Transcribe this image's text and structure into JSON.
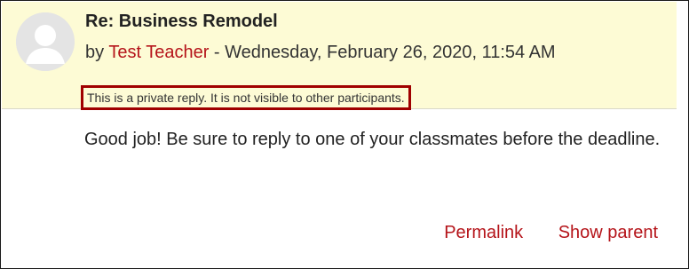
{
  "post": {
    "title": "Re: Business Remodel",
    "by_prefix": "by ",
    "author": "Test Teacher",
    "date_sep": " - ",
    "date": "Wednesday, February 26, 2020, 11:54 AM",
    "private_note": "This is a private reply. It is not visible to other participants.",
    "message": "Good job! Be sure to reply to one of your classmates before the deadline."
  },
  "commands": {
    "permalink": "Permalink",
    "show_parent": "Show parent"
  },
  "colors": {
    "header_bg": "#fdfbd5",
    "link": "#b5141a",
    "highlight_border": "#a00000"
  }
}
